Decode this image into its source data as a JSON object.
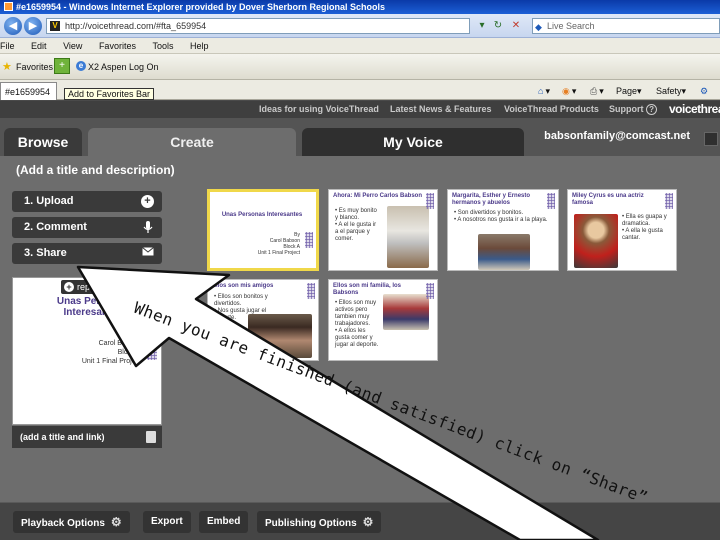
{
  "window": {
    "title": "#e1659954 - Windows Internet Explorer provided by Dover Sherborn Regional Schools"
  },
  "browser": {
    "address": "http://voicethread.com/#fta_659954",
    "search_placeholder": "Live Search",
    "menu": [
      "File",
      "Edit",
      "View",
      "Favorites",
      "Tools",
      "Help"
    ],
    "favorites_label": "Favorites",
    "link_label": "X2 Aspen Log On",
    "tab_label": "#e1659954",
    "tooltip": "Add to Favorites Bar",
    "commands": {
      "page": "Page",
      "safety": "Safety"
    }
  },
  "vt_nav": {
    "links": [
      "Ideas for using VoiceThread",
      "Latest News & Features",
      "VoiceThread Products",
      "Support"
    ],
    "logo": "voicethread"
  },
  "tabs": {
    "browse": "Browse",
    "create": "Create",
    "myvoice": "My Voice"
  },
  "user_email": "babsonfamily@comcast.net",
  "create": {
    "add_title": "(Add a title and description)",
    "steps": [
      {
        "label": "1. Upload",
        "icon": "plus-circle-icon"
      },
      {
        "label": "2. Comment",
        "icon": "microphone-icon"
      },
      {
        "label": "3. Share",
        "icon": "envelope-icon"
      }
    ],
    "preview": {
      "replace_label": "replace",
      "title": "Unas Personas Interesantes",
      "lines": [
        "By",
        "Carol Babson",
        "Block A",
        "Unit 1 Final Project"
      ],
      "add_link": "(add a title and link)"
    }
  },
  "slides": [
    {
      "title": "Unas Personas Interesantes",
      "body": "By\nCarol Babson\nBlock A\nUnit 1 Final Project"
    },
    {
      "title": "Ahora: Mi Perro Carlos Babson",
      "body": "• Es muy bonito y blanco.\n• A el le gusta ir a el parque y comer."
    },
    {
      "title": "Margarita, Esther y Ernesto hermanos y abuelos",
      "body": "• Son divertidos y bonitos.\n• A nosotros nos gusta ir a la playa."
    },
    {
      "title": "Miley Cyrus es una actriz famosa",
      "body": "• Ella es guapa y dramatica.\n• A ella le gusta cantar."
    },
    {
      "title": "Ellos son mis amigos",
      "body": "• Ellos son bonitos y divertidos.\n• Nos gusta jugar el deporte."
    },
    {
      "title": "Ellos son mi familia, los Babsons",
      "body": "• Ellos son muy activos pero tambien muy trabajadores.\n• A ellos les gusta comer y jugar al deporte."
    }
  ],
  "annotation": "When you are finished (and satisfied) click on “Share”",
  "bottom": {
    "playback": "Playback Options",
    "export": "Export",
    "embed": "Embed",
    "publishing": "Publishing Options"
  }
}
